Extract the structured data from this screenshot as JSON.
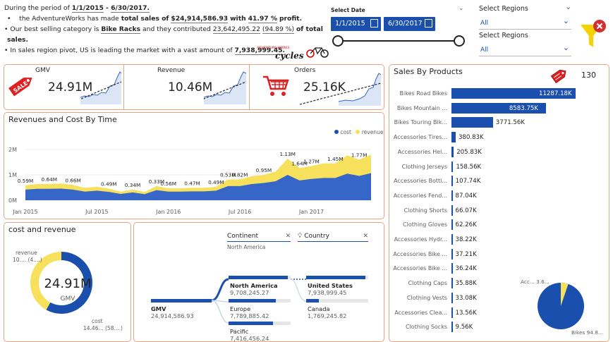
{
  "summary": {
    "line1_pre": "During the period of",
    "date_from": "1/1/2015",
    "dash": " - ",
    "date_to": "6/30/2017.",
    "line2_pre": "the AdventureWorks has made",
    "line2_total": "total sales of",
    "total_sales": "$24,914,586.93",
    "with": "with",
    "profit_pct": "41.97 %",
    "profit": "profit.",
    "line3_pre": "Our best selling category is",
    "best_category": "Bike Racks",
    "line3_mid": "and they contributed",
    "best_value": "23,642,495.22",
    "best_pct": "(94.89 %)",
    "line3_end": "of total",
    "line3_end2": "sales.",
    "line4_pre": "In sales region pivot, US is leading the market with a vast amount of",
    "us_value": "7,938,999.45."
  },
  "logo": {
    "text1": "ADVENTURE WORKS",
    "text2": "cycles"
  },
  "date_filter": {
    "label": "Select Date",
    "from": "1/1/2015",
    "to": "6/30/2017",
    "slider_position_pct": 100
  },
  "region_filter_1": {
    "label": "Select Regions",
    "value": "All"
  },
  "region_filter_2": {
    "label": "Select Regions",
    "value": "All"
  },
  "colors": {
    "primary": "#1a4fae",
    "accent": "#f6e05c",
    "border": "#e9a483",
    "sale_red": "#e02020",
    "funnel": "#f4d300"
  },
  "kpis": [
    {
      "title": "GMV",
      "value": "24.91M",
      "icon": "sale-tag-icon",
      "icon_text": "SALE"
    },
    {
      "title": "Revenue",
      "value": "10.46M"
    },
    {
      "title": "Orders",
      "value": "25.16K",
      "icon": "shopping-cart-icon"
    }
  ],
  "revenue_chart": {
    "title": "Revenues and Cost By Time",
    "legend": [
      {
        "name": "cost",
        "color": "#1a4fae"
      },
      {
        "name": "revenue",
        "color": "#f6e05c"
      }
    ],
    "y_ticks": [
      "2M",
      "1M",
      "0M"
    ],
    "x_ticks": [
      "Jan 2015",
      "Jul 2015",
      "Jan 2016",
      "Jul 2016",
      "Jan 2017"
    ]
  },
  "chart_data": {
    "type": "area",
    "title": "Revenues and Cost By Time",
    "ylim": [
      0,
      2000000
    ],
    "x": [
      "2015-01",
      "2015-02",
      "2015-03",
      "2015-04",
      "2015-05",
      "2015-06",
      "2015-07",
      "2015-08",
      "2015-09",
      "2015-10",
      "2015-11",
      "2015-12",
      "2016-01",
      "2016-02",
      "2016-03",
      "2016-04",
      "2016-05",
      "2016-06",
      "2016-07",
      "2016-08",
      "2016-09",
      "2016-10",
      "2016-11",
      "2016-12",
      "2017-01",
      "2017-02",
      "2017-03",
      "2017-04",
      "2017-05",
      "2017-06"
    ],
    "series": [
      {
        "name": "revenue",
        "values": [
          590000,
          640000,
          640000,
          660000,
          600000,
          490000,
          530000,
          460000,
          340000,
          420000,
          330000,
          560000,
          470000,
          470000,
          490000,
          490000,
          530000,
          820000,
          820000,
          950000,
          1000000,
          1130000,
          1640000,
          1270000,
          1350000,
          1450000,
          1450000,
          1770000,
          1600000,
          1800000
        ]
      },
      {
        "name": "cost",
        "values": [
          420000,
          450000,
          450000,
          460000,
          420000,
          340000,
          380000,
          330000,
          250000,
          310000,
          240000,
          400000,
          340000,
          340000,
          350000,
          350000,
          380000,
          560000,
          560000,
          640000,
          680000,
          750000,
          1000000,
          780000,
          840000,
          880000,
          880000,
          1050000,
          960000,
          1070000
        ]
      }
    ],
    "data_labels": [
      {
        "x": "2015-01",
        "label": "0.59M"
      },
      {
        "x": "2015-03",
        "label": "0.64M"
      },
      {
        "x": "2015-05",
        "label": "0.66M"
      },
      {
        "x": "2015-08",
        "label": "0.49M"
      },
      {
        "x": "2015-10",
        "label": "0.34M"
      },
      {
        "x": "2015-12",
        "label": "0.33M"
      },
      {
        "x": "2016-01",
        "label": "0.56M"
      },
      {
        "x": "2016-03",
        "label": "0.47M"
      },
      {
        "x": "2016-05",
        "label": "0.49M"
      },
      {
        "x": "2016-06",
        "label": "0.53M"
      },
      {
        "x": "2016-07",
        "label": "0.82M"
      },
      {
        "x": "2016-09",
        "label": "0.95M"
      },
      {
        "x": "2016-11",
        "label": "1.13M"
      },
      {
        "x": "2016-12",
        "label": "1.64M"
      },
      {
        "x": "2017-01",
        "label": "1.27M"
      },
      {
        "x": "2017-03",
        "label": "1.45M"
      },
      {
        "x": "2017-05",
        "label": "1.77M"
      }
    ]
  },
  "donut": {
    "title": "cost and revenue",
    "center_value": "24.91M",
    "center_label": "GMV",
    "revenue_label": "revenue",
    "revenue_detail": "10.... (4....)",
    "cost_label": "cost",
    "cost_detail": "14.46... (58....)",
    "revenue_pct": 41.97
  },
  "tree": {
    "continent_header": "Continent",
    "continent_value": "North America",
    "country_header": "Country",
    "root": {
      "label": "GMV",
      "value": "24,914,586.93"
    },
    "level1": [
      {
        "label": "North America",
        "value": "9,708,245.27",
        "pct": 0.95,
        "bold": true
      },
      {
        "label": "Europe",
        "value": "7,789,885.42",
        "pct": 0.76
      },
      {
        "label": "Pacific",
        "value": "7,416,456.24",
        "pct": 0.72
      }
    ],
    "level2": [
      {
        "label": "United States",
        "value": "7,938,999.45",
        "pct": 0.95,
        "bold": true
      },
      {
        "label": "Canada",
        "value": "1,769,245.82",
        "pct": 0.21
      }
    ]
  },
  "sales_by_products": {
    "title": "Sales By Products",
    "count": "130",
    "items": [
      {
        "label": "Bikes Road Bikes",
        "value": 11287.18,
        "display": "11287.18K"
      },
      {
        "label": "Bikes Mountain ...",
        "value": 8583.75,
        "display": "8583.75K"
      },
      {
        "label": "Bikes Touring Bik...",
        "value": 3771.56,
        "display": "3771.56K"
      },
      {
        "label": "Accessories Tires...",
        "value": 380.83,
        "display": "380.83K"
      },
      {
        "label": "Accessories Hel...",
        "value": 205.83,
        "display": "205.83K"
      },
      {
        "label": "Clothing Jerseys",
        "value": 158.56,
        "display": "158.56K"
      },
      {
        "label": "Accessories Bottl...",
        "value": 107.74,
        "display": "107.74K"
      },
      {
        "label": "Accessories Fend...",
        "value": 87.04,
        "display": "87.04K"
      },
      {
        "label": "Clothing Shorts",
        "value": 66.07,
        "display": "66.07K"
      },
      {
        "label": "Clothing Gloves",
        "value": 62.26,
        "display": "62.26K"
      },
      {
        "label": "Accessories Hydr...",
        "value": 38.22,
        "display": "38.22K"
      },
      {
        "label": "Accessories Bike ...",
        "value": 37.21,
        "display": "37.21K"
      },
      {
        "label": "Accessories Bike ...",
        "value": 36.24,
        "display": "36.24K"
      },
      {
        "label": "Clothing Caps",
        "value": 35.88,
        "display": "35.88K"
      },
      {
        "label": "Clothing Vests",
        "value": 33.08,
        "display": "33.08K"
      },
      {
        "label": "Accessories Clea...",
        "value": 13.56,
        "display": "13.56K"
      },
      {
        "label": "Clothing Socks",
        "value": 9.56,
        "display": "9.56K"
      }
    ],
    "pie": {
      "acc_label": "Acc... 3.6...",
      "bikes_label": "Bikes 94.8...",
      "acc_pct": 5.2
    }
  }
}
